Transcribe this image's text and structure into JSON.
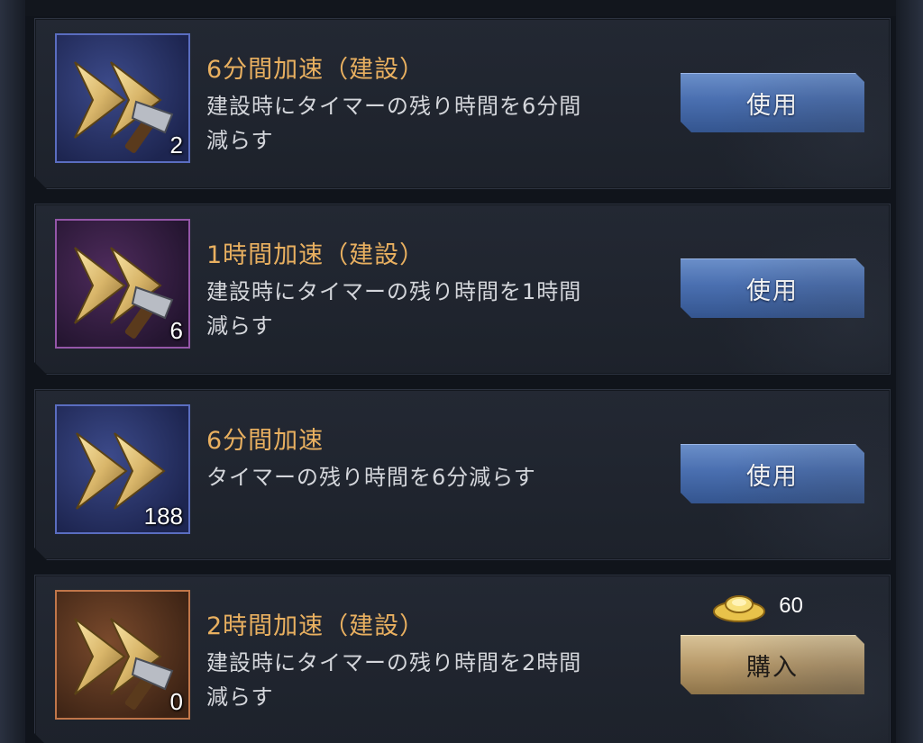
{
  "items": [
    {
      "title": "6分間加速（建設）",
      "desc_line1": "建設時にタイマーの残り時間を6分間",
      "desc_line2": "減らす",
      "count": "2",
      "icon": "double-arrow-hammer-icon",
      "frame_color": "#5a6dc0",
      "button_label": "使用"
    },
    {
      "title": "1時間加速（建設）",
      "desc_line1": "建設時にタイマーの残り時間を1時間",
      "desc_line2": "減らす",
      "count": "6",
      "icon": "double-arrow-hammer-icon",
      "frame_color": "#9456a8",
      "button_label": "使用"
    },
    {
      "title": "6分間加速",
      "desc_line1": "タイマーの残り時間を6分減らす",
      "desc_line2": "",
      "count": "188",
      "icon": "double-arrow-icon",
      "frame_color": "#5a6dc0",
      "button_label": "使用"
    },
    {
      "title": "2時間加速（建設）",
      "desc_line1": "建設時にタイマーの残り時間を2時間",
      "desc_line2": "減らす",
      "count": "0",
      "icon": "double-arrow-hammer-icon",
      "frame_color": "#c0764a",
      "button_label": "購入",
      "price": "60",
      "price_icon": "gold-ingot-icon"
    }
  ],
  "colors": {
    "title": "#e9b060",
    "use_button": "#4a6fb0",
    "buy_button": "#b89a6a"
  }
}
